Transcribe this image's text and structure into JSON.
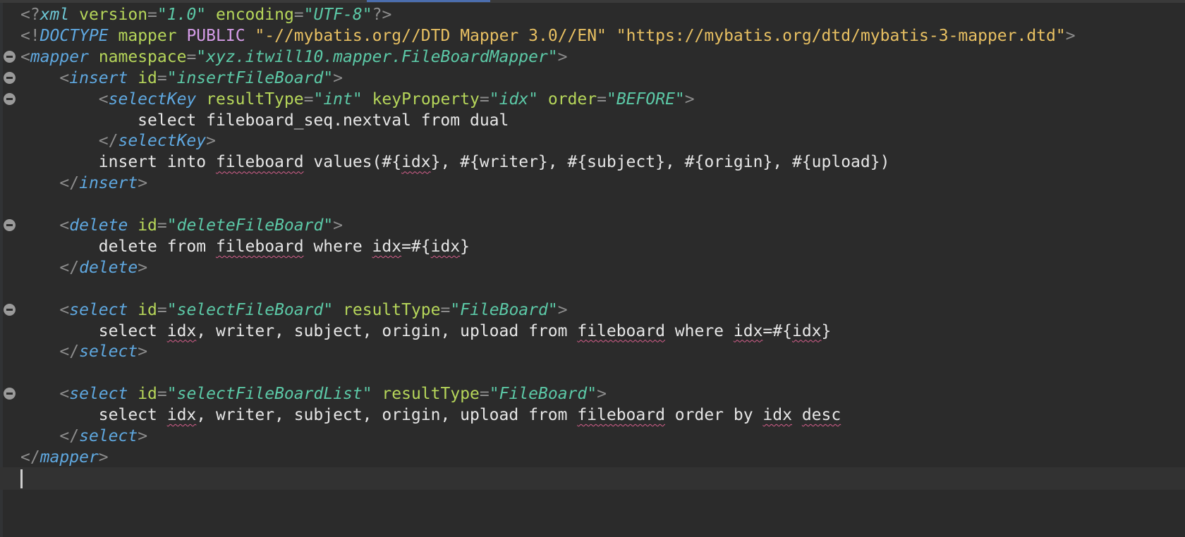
{
  "editor": {
    "language": "xml",
    "colors": {
      "background": "#2b2b2b",
      "current_line": "#323232",
      "bracket": "#8d8d8d",
      "tag": "#5fa8e0",
      "attribute": "#b6d65a",
      "attribute_value": "#5cc9a7",
      "doctype_string": "#e8c062",
      "keyword": "#d59ce8",
      "text": "#e6e6e6",
      "spell_underline": "#d65f8c"
    },
    "icons": {
      "fold": "fold-collapse-icon"
    },
    "lines": [
      {
        "fold": false,
        "tokens": [
          [
            "br",
            "<?"
          ],
          [
            "pi",
            "xml"
          ],
          [
            "tx",
            " "
          ],
          [
            "att",
            "version"
          ],
          [
            "br",
            "="
          ],
          [
            "val",
            "\"1.0\""
          ],
          [
            "tx",
            " "
          ],
          [
            "att",
            "encoding"
          ],
          [
            "br",
            "="
          ],
          [
            "val",
            "\"UTF-8\""
          ],
          [
            "br",
            "?>"
          ]
        ]
      },
      {
        "fold": false,
        "tokens": [
          [
            "br",
            "<!"
          ],
          [
            "tag",
            "DOCTYPE"
          ],
          [
            "tx",
            " "
          ],
          [
            "att",
            "mapper"
          ],
          [
            "tx",
            " "
          ],
          [
            "kw",
            "PUBLIC"
          ],
          [
            "tx",
            " "
          ],
          [
            "dqs",
            "\"-//mybatis.org//DTD Mapper 3.0//EN\""
          ],
          [
            "tx",
            " "
          ],
          [
            "dqs",
            "\"https://mybatis.org/dtd/mybatis-3-mapper.dtd\""
          ],
          [
            "br",
            ">"
          ]
        ]
      },
      {
        "fold": true,
        "tokens": [
          [
            "br",
            "<"
          ],
          [
            "tag",
            "mapper"
          ],
          [
            "tx",
            " "
          ],
          [
            "att",
            "namespace"
          ],
          [
            "br",
            "="
          ],
          [
            "val",
            "\"xyz.itwill10.mapper.FileBoardMapper\""
          ],
          [
            "br",
            ">"
          ]
        ]
      },
      {
        "fold": true,
        "tokens": [
          [
            "tx",
            "    "
          ],
          [
            "br",
            "<"
          ],
          [
            "tag",
            "insert"
          ],
          [
            "tx",
            " "
          ],
          [
            "att",
            "id"
          ],
          [
            "br",
            "="
          ],
          [
            "val",
            "\"insertFileBoard\""
          ],
          [
            "br",
            ">"
          ]
        ]
      },
      {
        "fold": true,
        "tokens": [
          [
            "tx",
            "        "
          ],
          [
            "br",
            "<"
          ],
          [
            "tag",
            "selectKey"
          ],
          [
            "tx",
            " "
          ],
          [
            "att",
            "resultType"
          ],
          [
            "br",
            "="
          ],
          [
            "val",
            "\"int\""
          ],
          [
            "tx",
            " "
          ],
          [
            "att",
            "keyProperty"
          ],
          [
            "br",
            "="
          ],
          [
            "val",
            "\"idx\""
          ],
          [
            "tx",
            " "
          ],
          [
            "att",
            "order"
          ],
          [
            "br",
            "="
          ],
          [
            "val",
            "\"BEFORE\""
          ],
          [
            "br",
            ">"
          ]
        ]
      },
      {
        "fold": false,
        "tokens": [
          [
            "tx",
            "            select fileboard_seq.nextval from dual"
          ]
        ]
      },
      {
        "fold": false,
        "tokens": [
          [
            "tx",
            "        "
          ],
          [
            "br",
            "</"
          ],
          [
            "tag",
            "selectKey"
          ],
          [
            "br",
            ">"
          ]
        ]
      },
      {
        "fold": false,
        "tokens": [
          [
            "tx",
            "        insert into "
          ],
          [
            "sp",
            "fileboard"
          ],
          [
            "tx",
            " values(#{"
          ],
          [
            "sp",
            "idx"
          ],
          [
            "tx",
            "}, #{writer}, #{subject}, #{origin}, #{upload})"
          ]
        ]
      },
      {
        "fold": false,
        "tokens": [
          [
            "tx",
            "    "
          ],
          [
            "br",
            "</"
          ],
          [
            "tag",
            "insert"
          ],
          [
            "br",
            ">"
          ]
        ]
      },
      {
        "fold": false,
        "tokens": []
      },
      {
        "fold": true,
        "tokens": [
          [
            "tx",
            "    "
          ],
          [
            "br",
            "<"
          ],
          [
            "tag",
            "delete"
          ],
          [
            "tx",
            " "
          ],
          [
            "att",
            "id"
          ],
          [
            "br",
            "="
          ],
          [
            "val",
            "\"deleteFileBoard\""
          ],
          [
            "br",
            ">"
          ]
        ]
      },
      {
        "fold": false,
        "tokens": [
          [
            "tx",
            "        delete from "
          ],
          [
            "sp",
            "fileboard"
          ],
          [
            "tx",
            " where "
          ],
          [
            "sp",
            "idx"
          ],
          [
            "tx",
            "=#{"
          ],
          [
            "sp",
            "idx"
          ],
          [
            "tx",
            "}"
          ]
        ]
      },
      {
        "fold": false,
        "tokens": [
          [
            "tx",
            "    "
          ],
          [
            "br",
            "</"
          ],
          [
            "tag",
            "delete"
          ],
          [
            "br",
            ">"
          ]
        ]
      },
      {
        "fold": false,
        "tokens": []
      },
      {
        "fold": true,
        "tokens": [
          [
            "tx",
            "    "
          ],
          [
            "br",
            "<"
          ],
          [
            "tag",
            "select"
          ],
          [
            "tx",
            " "
          ],
          [
            "att",
            "id"
          ],
          [
            "br",
            "="
          ],
          [
            "val",
            "\"selectFileBoard\""
          ],
          [
            "tx",
            " "
          ],
          [
            "att",
            "resultType"
          ],
          [
            "br",
            "="
          ],
          [
            "val",
            "\"FileBoard\""
          ],
          [
            "br",
            ">"
          ]
        ]
      },
      {
        "fold": false,
        "tokens": [
          [
            "tx",
            "        select "
          ],
          [
            "sp",
            "idx"
          ],
          [
            "tx",
            ", writer, subject, origin, upload from "
          ],
          [
            "sp",
            "fileboard"
          ],
          [
            "tx",
            " where "
          ],
          [
            "sp",
            "idx"
          ],
          [
            "tx",
            "=#{"
          ],
          [
            "sp",
            "idx"
          ],
          [
            "tx",
            "}"
          ]
        ]
      },
      {
        "fold": false,
        "tokens": [
          [
            "tx",
            "    "
          ],
          [
            "br",
            "</"
          ],
          [
            "tag",
            "select"
          ],
          [
            "br",
            ">"
          ]
        ]
      },
      {
        "fold": false,
        "tokens": []
      },
      {
        "fold": true,
        "tokens": [
          [
            "tx",
            "    "
          ],
          [
            "br",
            "<"
          ],
          [
            "tag",
            "select"
          ],
          [
            "tx",
            " "
          ],
          [
            "att",
            "id"
          ],
          [
            "br",
            "="
          ],
          [
            "val",
            "\"selectFileBoardList\""
          ],
          [
            "tx",
            " "
          ],
          [
            "att",
            "resultType"
          ],
          [
            "br",
            "="
          ],
          [
            "val",
            "\"FileBoard\""
          ],
          [
            "br",
            ">"
          ]
        ]
      },
      {
        "fold": false,
        "tokens": [
          [
            "tx",
            "        select "
          ],
          [
            "sp",
            "idx"
          ],
          [
            "tx",
            ", writer, subject, origin, upload from "
          ],
          [
            "sp",
            "fileboard"
          ],
          [
            "tx",
            " order by "
          ],
          [
            "sp",
            "idx"
          ],
          [
            "tx",
            " "
          ],
          [
            "sp",
            "desc"
          ]
        ]
      },
      {
        "fold": false,
        "tokens": [
          [
            "tx",
            "    "
          ],
          [
            "br",
            "</"
          ],
          [
            "tag",
            "select"
          ],
          [
            "br",
            ">"
          ]
        ]
      },
      {
        "fold": false,
        "tokens": [
          [
            "br",
            "</"
          ],
          [
            "tag",
            "mapper"
          ],
          [
            "br",
            ">"
          ]
        ]
      },
      {
        "fold": false,
        "current": true,
        "tokens": []
      }
    ]
  }
}
